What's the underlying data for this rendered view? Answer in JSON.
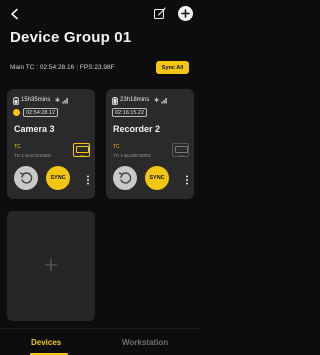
{
  "header": {
    "title": "Device Group 01",
    "main_tc_label": "Main TC",
    "main_tc_value": "02:54:28.16",
    "fps_label": "FPS",
    "fps_value": "23.98F",
    "sync_all_label": "Sync All"
  },
  "devices": [
    {
      "battery": "15h35mins",
      "timecode": "02:54:28.12",
      "name": "Camera 3",
      "tc_label": "TC",
      "serial": "TC-1 Box/3C60ED",
      "monitor_label": "NDI",
      "monitor_active": true,
      "sync_label": "SYNC"
    },
    {
      "battery": "23h18mins",
      "timecode": "02:16:15.22",
      "name": "Recorder 2",
      "tc_label": "TC",
      "serial": "TC-1 Box/BC90ED",
      "monitor_label": "NDI",
      "monitor_active": false,
      "sync_label": "SYNC"
    }
  ],
  "tabs": [
    {
      "label": "Devices",
      "active": true
    },
    {
      "label": "Workstation",
      "active": false
    }
  ],
  "colors": {
    "accent": "#f3c614",
    "background": "#0d0d0d",
    "card": "#2a2a2a"
  }
}
